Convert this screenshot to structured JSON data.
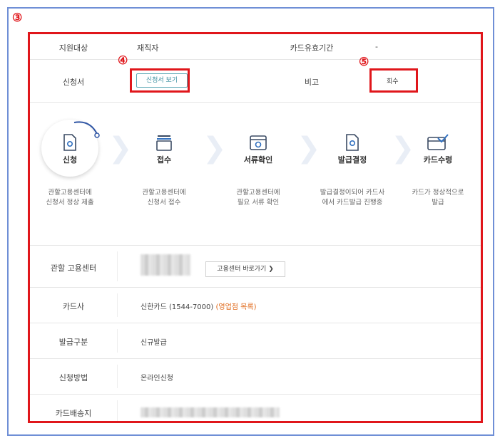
{
  "annotations": {
    "a3": "③",
    "a4": "④",
    "a5": "⑤"
  },
  "top_table": {
    "row1": {
      "label1": "지원대상",
      "value1": "재직자",
      "label2": "카드유효기간",
      "value2": "-"
    },
    "row2": {
      "label1": "신청서",
      "view_button": "신청서 보기",
      "label2": "비고",
      "withdraw_button": "회수"
    }
  },
  "steps": [
    {
      "title": "신청",
      "desc1": "관할고용센터에",
      "desc2": "신청서 정상 제출",
      "icon": "document-icon"
    },
    {
      "title": "접수",
      "desc1": "관할고용센터에",
      "desc2": "신청서 접수",
      "icon": "folder-icon"
    },
    {
      "title": "서류확인",
      "desc1": "관할고용센터에",
      "desc2": "필요 서류 확인",
      "icon": "inbox-check-icon"
    },
    {
      "title": "발급결정",
      "desc1": "발급결정이되어 카드사",
      "desc2": "에서 카드발급 진행중",
      "icon": "document-check-icon"
    },
    {
      "title": "카드수령",
      "desc1": "카드가 정상적으로",
      "desc2": "발급",
      "icon": "card-check-icon"
    }
  ],
  "info": {
    "center": {
      "label": "관할 고용센터",
      "button": "고용센터 바로가기 ❯"
    },
    "card_company": {
      "label": "카드사",
      "value": "신한카드 (1544-7000)",
      "link": "(영업점 목록)"
    },
    "issue_type": {
      "label": "발급구분",
      "value": "신규발급"
    },
    "apply_method": {
      "label": "신청방법",
      "value": "온라인신청"
    },
    "delivery": {
      "label": "카드배송지"
    }
  },
  "colors": {
    "annotation_red": "#e0161b",
    "frame_blue": "#6f8fd6",
    "accent_teal": "#3a8fa0",
    "link_orange": "#e06a1b"
  }
}
